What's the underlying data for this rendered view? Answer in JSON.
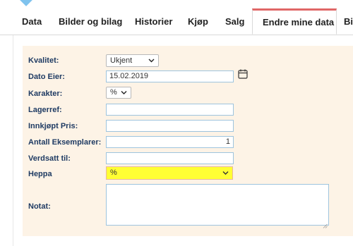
{
  "tabs": [
    {
      "label": "Data"
    },
    {
      "label": "Bilder og bilag"
    },
    {
      "label": "Historier"
    },
    {
      "label": "Kjøp"
    },
    {
      "label": "Salg"
    },
    {
      "label": "Endre mine data",
      "active": true
    },
    {
      "label": "Bi"
    }
  ],
  "form": {
    "kvalitet": {
      "label": "Kvalitet:",
      "value": "Ukjent"
    },
    "dato_eier": {
      "label": "Dato Eier:",
      "value": "15.02.2019"
    },
    "karakter": {
      "label": "Karakter:",
      "value": "%"
    },
    "lagerref": {
      "label": "Lagerref:",
      "value": ""
    },
    "innkjopt_pris": {
      "label": "Innkjøpt Pris:",
      "value": ""
    },
    "antall": {
      "label": "Antall Eksemplarer:",
      "value": "1"
    },
    "verdsatt": {
      "label": "Verdsatt til:",
      "value": ""
    },
    "heppa": {
      "label": "Heppa",
      "value": "%"
    },
    "notat": {
      "label": "Notat:",
      "value": ""
    }
  },
  "colors": {
    "accent_tab": "#e06666",
    "panel_bg": "#fdf3e6",
    "label": "#1f3b63",
    "highlight": "#ffff33"
  },
  "icons": [
    "calendar-icon",
    "chevron-down-icon",
    "resize-grip-icon"
  ]
}
